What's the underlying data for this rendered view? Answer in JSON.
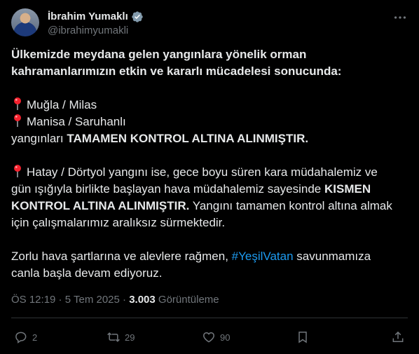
{
  "author": {
    "display_name": "İbrahim Yumaklı",
    "handle": "@ibrahimyumakli"
  },
  "tweet": {
    "intro_line1": "Ülkemizde meydana gelen yangınlara yönelik orman",
    "intro_line2": "kahramanlarımızın etkin ve kararlı mücadelesi sonucunda:",
    "location1": "Muğla / Milas",
    "location2": "Manisa / Saruhanlı",
    "status_prefix": "yangınları ",
    "status_bold": "TAMAMEN KONTROL ALTINA ALINMIŞTIR.",
    "hatay_line1": "Hatay / Dörtyol yangını ise, gece boyu süren kara müdahalemiz ve",
    "hatay_line2_prefix": "gün ışığıyla birlikte başlayan hava müdahalemiz sayesinde ",
    "hatay_line2_bold": "KISMEN",
    "hatay_line3_bold": "KONTROL ALTINA ALINMIŞTIR.",
    "hatay_line3_rest": " Yangını tamamen kontrol altına almak",
    "hatay_line4": "için çalışmalarımız aralıksız sürmektedir.",
    "closing_line1_prefix": "Zorlu hava şartlarına ve alevlere rağmen, ",
    "hashtag": "#YeşilVatan",
    "closing_line1_suffix": " savunmamıza",
    "closing_line2": "canla başla devam ediyoruz."
  },
  "meta": {
    "time": "ÖS 12:19",
    "separator": " · ",
    "date": "5 Tem 2025",
    "views_count": "3.003",
    "views_label": " Görüntüleme"
  },
  "actions": {
    "replies": "2",
    "reposts": "29",
    "likes": "90"
  },
  "icons": {
    "verified": "verified-badge-icon",
    "more": "more-dots-icon",
    "pin": "round-pushpin-icon",
    "reply": "reply-bubble-icon",
    "repost": "repost-arrows-icon",
    "like": "heart-icon",
    "bookmark": "bookmark-icon",
    "share": "share-upload-icon"
  },
  "colors": {
    "background": "#000000",
    "text": "#e7e9ea",
    "muted": "#71767b",
    "accent": "#1d9bf0",
    "pin": "#f4212e"
  }
}
